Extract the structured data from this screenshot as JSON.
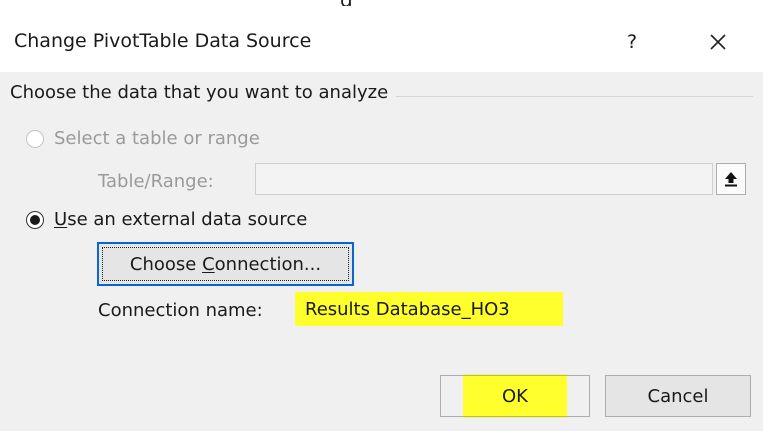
{
  "dialog": {
    "title": "Change PivotTable Data Source",
    "help_label": "?",
    "close_label": "Close"
  },
  "group": {
    "label": "Choose the data that you want to analyze"
  },
  "option_table": {
    "label": "Select a table or range",
    "selected": false,
    "enabled": false
  },
  "table_range": {
    "label": "Table/Range:",
    "value": "",
    "collapse_icon": "collapse-dialog-arrow-icon"
  },
  "option_external": {
    "mnemonic": "U",
    "label_rest": "se an external data source",
    "selected": true,
    "enabled": true
  },
  "choose_connection": {
    "label_before": "Choose ",
    "mnemonic": "C",
    "label_after": "onnection..."
  },
  "connection": {
    "label": "Connection name:",
    "value": "Results Database_HO3"
  },
  "buttons": {
    "ok": "OK",
    "cancel": "Cancel"
  },
  "colors": {
    "highlight": "#ffff2e",
    "focus_border": "#0a64d2",
    "dialog_bg": "#f0f0f0"
  }
}
